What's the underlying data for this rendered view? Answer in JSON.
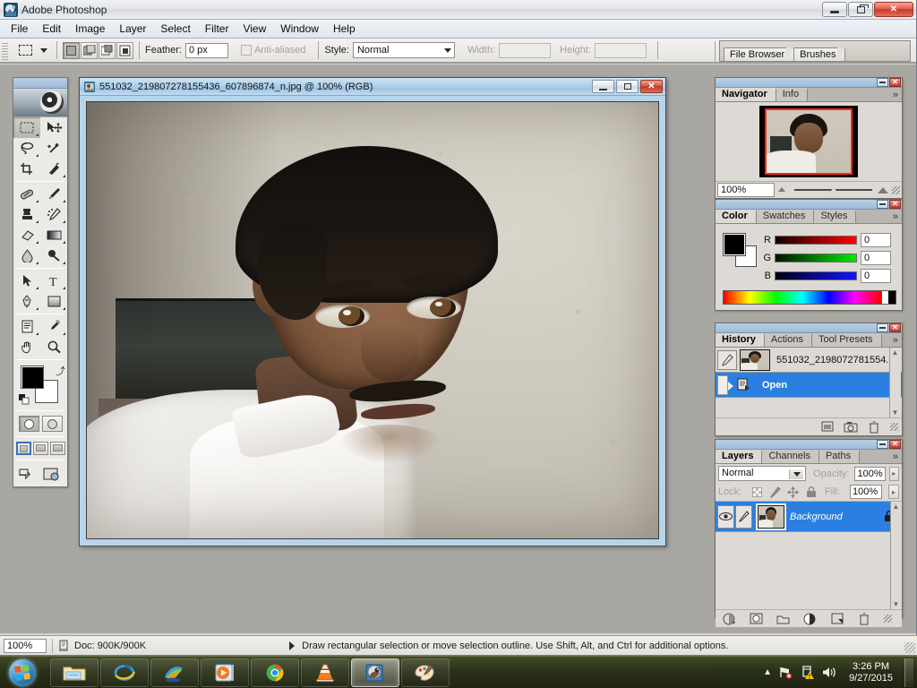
{
  "app": {
    "title": "Adobe Photoshop",
    "icon": "photoshop-icon",
    "window_controls": {
      "minimize": "minimize",
      "restore": "restore",
      "close": "close"
    }
  },
  "menubar": {
    "items": [
      "File",
      "Edit",
      "Image",
      "Layer",
      "Select",
      "Filter",
      "View",
      "Window",
      "Help"
    ]
  },
  "options_bar": {
    "tool_preset_icon": "rectangular-marquee-icon",
    "selection_modes": [
      "new-selection",
      "add-to-selection",
      "subtract-from-selection",
      "intersect-with-selection"
    ],
    "active_selection_mode": 0,
    "feather_label": "Feather:",
    "feather_value": "0 px",
    "antialiased_label": "Anti-aliased",
    "antialiased_checked": false,
    "style_label": "Style:",
    "style_value": "Normal",
    "width_label": "Width:",
    "width_value": "",
    "height_label": "Height:",
    "height_value": "",
    "palette_well": [
      "File Browser",
      "Brushes"
    ]
  },
  "toolbox": {
    "tools": [
      "rectangular-marquee-tool",
      "move-tool",
      "lasso-tool",
      "magic-wand-tool",
      "crop-tool",
      "slice-tool",
      "healing-brush-tool",
      "brush-tool",
      "clone-stamp-tool",
      "history-brush-tool",
      "eraser-tool",
      "gradient-tool",
      "blur-tool",
      "dodge-tool",
      "path-selection-tool",
      "type-tool",
      "pen-tool",
      "shape-tool",
      "notes-tool",
      "eyedropper-tool",
      "hand-tool",
      "zoom-tool"
    ],
    "active_tool": "rectangular-marquee-tool",
    "foreground_color": "#000000",
    "background_color": "#ffffff",
    "quick_mask_modes": [
      "standard-mode",
      "quick-mask-mode"
    ],
    "screen_modes": [
      "standard-screen-mode",
      "full-screen-with-menubar",
      "full-screen-mode"
    ],
    "active_screen_mode": 0,
    "jump_buttons": [
      "jump-to-imageready",
      "jump-to-browser"
    ]
  },
  "document": {
    "title": "551032_219807278155436_607896874_n.jpg @ 100% (RGB)",
    "icon": "document-icon",
    "window_controls": {
      "minimize": "minimize",
      "restore": "restore",
      "close": "close"
    }
  },
  "navigator": {
    "tabs": [
      "Navigator",
      "Info"
    ],
    "active_tab": "Navigator",
    "zoom_value": "100%",
    "menu_icon": "double-chevron-icon",
    "zoom_out_icon": "small-mountain-icon",
    "zoom_in_icon": "large-mountain-icon",
    "view_box_color": "#ff2a1c"
  },
  "color": {
    "tabs": [
      "Color",
      "Swatches",
      "Styles"
    ],
    "active_tab": "Color",
    "channels": [
      {
        "label": "R",
        "value": "0"
      },
      {
        "label": "G",
        "value": "0"
      },
      {
        "label": "B",
        "value": "0"
      }
    ],
    "menu_icon": "double-chevron-icon"
  },
  "history": {
    "tabs": [
      "History",
      "Actions",
      "Tool Presets"
    ],
    "active_tab": "History",
    "snapshot": "551032_2198072781554...",
    "states": [
      {
        "label": "Open",
        "active": true
      }
    ],
    "footer_icons": [
      "new-document-from-state-icon",
      "new-snapshot-icon",
      "delete-state-icon"
    ],
    "menu_icon": "double-chevron-icon"
  },
  "layers": {
    "tabs": [
      "Layers",
      "Channels",
      "Paths"
    ],
    "active_tab": "Layers",
    "blend_mode": "Normal",
    "opacity_label": "Opacity:",
    "opacity_value": "100%",
    "lock_label": "Lock:",
    "lock_icons": [
      "lock-transparent-pixels-icon",
      "lock-image-pixels-icon",
      "lock-position-icon",
      "lock-all-icon"
    ],
    "fill_label": "Fill:",
    "fill_value": "100%",
    "rows": [
      {
        "name": "Background",
        "visible": true,
        "locked": true,
        "selected": true
      }
    ],
    "footer_icons": [
      "layer-style-icon",
      "layer-mask-icon",
      "new-group-icon",
      "adjustment-layer-icon",
      "new-layer-icon",
      "delete-layer-icon"
    ],
    "menu_icon": "double-chevron-icon"
  },
  "status_bar": {
    "zoom": "100%",
    "doc_icon": "document-size-icon",
    "doc_info": "Doc: 900K/900K",
    "hint": "Draw rectangular selection or move selection outline.  Use Shift, Alt, and Ctrl for additional options."
  },
  "taskbar": {
    "start_button": "start-orb",
    "items": [
      "windows-explorer-icon",
      "internet-explorer-icon",
      "windows-photo-gallery-icon",
      "windows-media-player-icon",
      "google-chrome-icon",
      "vlc-media-player-icon",
      "adobe-photoshop-icon",
      "microsoft-paint-icon"
    ],
    "active_item": "adobe-photoshop-icon",
    "tray_icons": [
      "show-hidden-icons-icon",
      "network-error-icon",
      "action-center-warning-icon",
      "volume-icon"
    ],
    "clock_time": "3:26 PM",
    "clock_date": "9/27/2015",
    "show_desktop": "show-desktop-button"
  }
}
